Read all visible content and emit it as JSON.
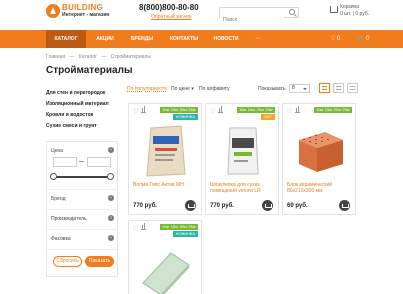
{
  "header": {
    "logo_name": "BUILDING",
    "logo_tagline": "Интернет - магазин",
    "phone": "8(800)800-80-80",
    "callback_label": "Обратный звонок",
    "search_placeholder": "Поиск",
    "cart_title": "Корзина",
    "cart_summary": "0 шт. | 0 руб."
  },
  "nav": {
    "items": [
      {
        "label": "КАТАЛОГ"
      },
      {
        "label": "АКЦИИ"
      },
      {
        "label": "БРЕНДЫ"
      },
      {
        "label": "КОНТАКТЫ"
      },
      {
        "label": "НОВОСТИ"
      },
      {
        "label": "···"
      }
    ],
    "fav_count": "♡ 0",
    "cart_count": "0"
  },
  "breadcrumb": [
    "Главная",
    "—",
    "Каталог",
    "—",
    "Стройматериалы"
  ],
  "page_title": "Стройматериалы",
  "sidebar": {
    "categories": [
      "Для стен и перегородок",
      "Изоляционный материал",
      "Кровли и водосток",
      "Сухие смеси и грунт"
    ],
    "filters": {
      "price_label": "Цена",
      "brand_label": "Бренд",
      "manufacturer_label": "Производитель",
      "packing_label": "Фасовка",
      "reset_label": "Сбросить",
      "show_label": "Показать"
    }
  },
  "sort": {
    "popular": "По популярности",
    "price": "По цене ▾",
    "alpha": "По алфавиту",
    "show_label": "Показывать",
    "show_value": "8"
  },
  "products": [
    {
      "name": "Волма Гипс Актив МН",
      "price": "770 руб.",
      "promo": "10кг 15кг 20кг 25кг",
      "badge": "НОВИНКА",
      "badge_color": "#2bb5a8"
    },
    {
      "name": "Шпаклевка для сухих помещений vetonit LR",
      "price": "770 руб.",
      "promo": "10кг 15кг 20кг 25кг",
      "badge": "ХИТ",
      "badge_color": "#f5a623"
    },
    {
      "name": "Блок керамический 80x210x300 мм",
      "price": "60 руб.",
      "promo": "10кг 15кг 20кг 25кг",
      "badge": "",
      "badge_color": ""
    },
    {
      "name": "",
      "price": "",
      "promo": "10кг 15кг 20кг 25кг",
      "badge": "НОВИНКА",
      "badge_color": "#2bb5a8"
    }
  ],
  "colors": {
    "accent": "#f07c1e",
    "nav_active": "#bd5b12",
    "promo": "#7cb932"
  }
}
